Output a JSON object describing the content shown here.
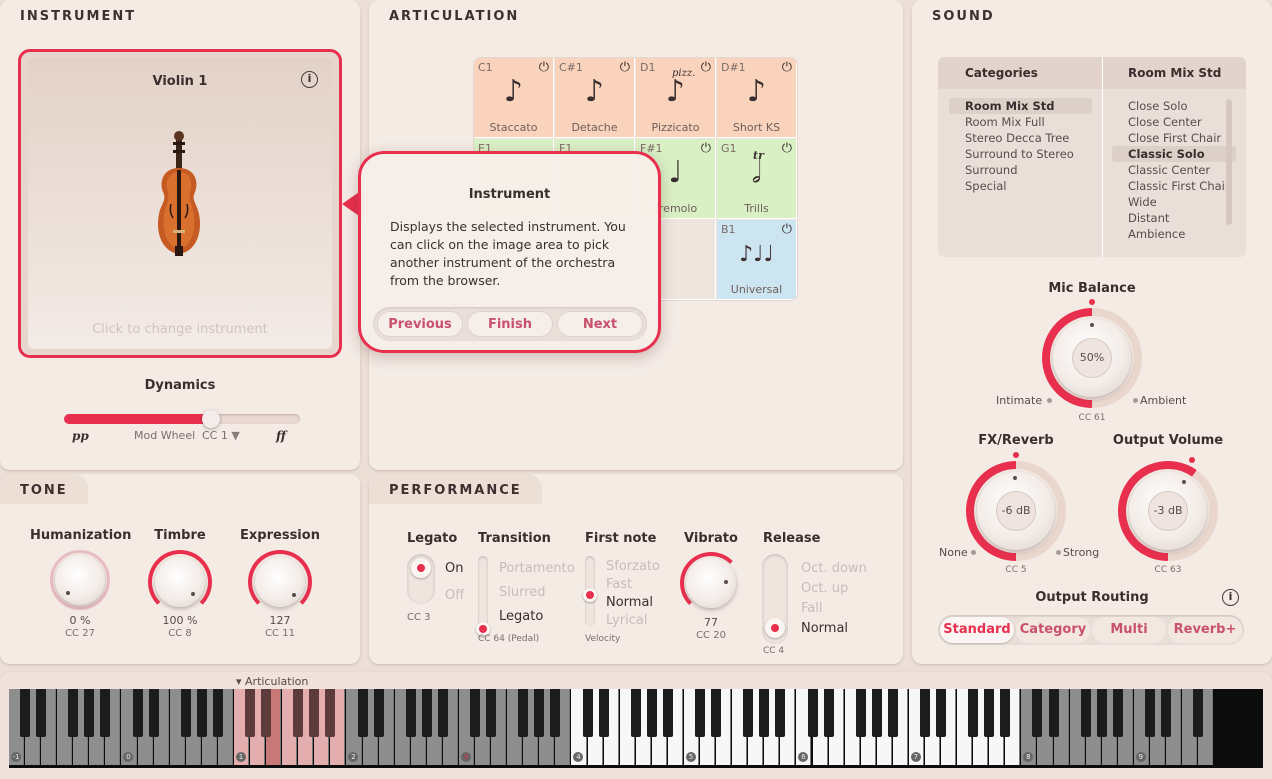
{
  "instrument": {
    "tab": "INSTRUMENT",
    "name": "Violin 1",
    "change_hint": "Click to change instrument",
    "dynamics_label": "Dynamics",
    "dyn_min": "pp",
    "dyn_max": "ff",
    "mod_source": "Mod Wheel",
    "cc": "CC 1",
    "dynamics_level": 0.6
  },
  "articulation": {
    "tab": "ARTICULATION",
    "cells": [
      {
        "note": "C1",
        "name": "Staccato",
        "glyph": "♪"
      },
      {
        "note": "C#1",
        "name": "Detache",
        "glyph": "♪"
      },
      {
        "note": "D1",
        "name": "Pizzicato",
        "glyph": "♪",
        "mark": "pizz."
      },
      {
        "note": "D#1",
        "name": "Short KS",
        "glyph": "♪"
      },
      {
        "note": "E1",
        "name": "",
        "glyph": ""
      },
      {
        "note": "F1",
        "name": "",
        "glyph": ""
      },
      {
        "note": "F#1",
        "name": "Tremolo",
        "glyph": "♩"
      },
      {
        "note": "G1",
        "name": "Trills",
        "glyph": "𝅗𝅥",
        "mark": "tr"
      },
      {
        "note": "B1",
        "name": "Universal",
        "glyph": "♪♩♩"
      }
    ],
    "tremolo_partial": "remolo"
  },
  "tooltip": {
    "title": "Instrument",
    "body": "Displays the selected instrument. You can click on the image area to pick another instrument of the orchestra from the browser.",
    "prev": "Previous",
    "finish": "Finish",
    "next": "Next"
  },
  "sound": {
    "tab": "SOUND",
    "categories_header": "Categories",
    "presets_header": "Room Mix Std",
    "categories": [
      "Room Mix Std",
      "Room Mix Full",
      "Stereo Decca Tree",
      "Surround to Stereo",
      "Surround",
      "Special"
    ],
    "presets": [
      "Close Solo",
      "Close Center",
      "Close First Chair",
      "Classic Solo",
      "Classic Center",
      "Classic First Chair",
      "Wide",
      "Distant",
      "Ambience"
    ],
    "mic_balance": {
      "label": "Mic Balance",
      "value": "50%",
      "left": "Intimate",
      "right": "Ambient",
      "cc": "CC 61"
    },
    "fx_reverb": {
      "label": "FX/Reverb",
      "value": "-6 dB",
      "left": "None",
      "right": "Strong",
      "cc": "CC 5"
    },
    "output_volume": {
      "label": "Output Volume",
      "value": "-3 dB",
      "cc": "CC 63"
    },
    "routing_label": "Output Routing",
    "routing": [
      "Standard",
      "Category",
      "Multi",
      "Reverb+"
    ]
  },
  "tone": {
    "tab": "TONE",
    "humanization": {
      "label": "Humanization",
      "value": "0 %",
      "cc": "CC 27"
    },
    "timbre": {
      "label": "Timbre",
      "value": "100 %",
      "cc": "CC 8"
    },
    "expression": {
      "label": "Expression",
      "value": "127",
      "cc": "CC 11"
    }
  },
  "performance": {
    "tab": "PERFORMANCE",
    "legato": {
      "label": "Legato",
      "on": "On",
      "off": "Off",
      "cc": "CC 3"
    },
    "transition": {
      "label": "Transition",
      "options": [
        "Portamento",
        "Slurred",
        "Legato"
      ],
      "cc": "CC 64 (Pedal)"
    },
    "first_note": {
      "label": "First note",
      "options": [
        "Sforzato",
        "Fast",
        "Normal",
        "Lyrical"
      ],
      "cc": "Velocity"
    },
    "vibrato": {
      "label": "Vibrato",
      "value": "77",
      "cc": "CC 20"
    },
    "release": {
      "label": "Release",
      "options": [
        "Oct. down",
        "Oct. up",
        "Fall",
        "Normal"
      ],
      "cc": "CC 4"
    }
  },
  "keyboard": {
    "articulation_label": "▾ Articulation",
    "octaves": [
      "-1",
      "0",
      "1",
      "2",
      "3",
      "4",
      "5",
      "6",
      "7",
      "8",
      "9"
    ]
  },
  "colors": {
    "accent": "#e8304e",
    "panel": "#f4ebe5",
    "staccato_bg": "#f9d3bc",
    "green_bg": "#d9f0c5",
    "blue_bg": "#cde5f1"
  }
}
